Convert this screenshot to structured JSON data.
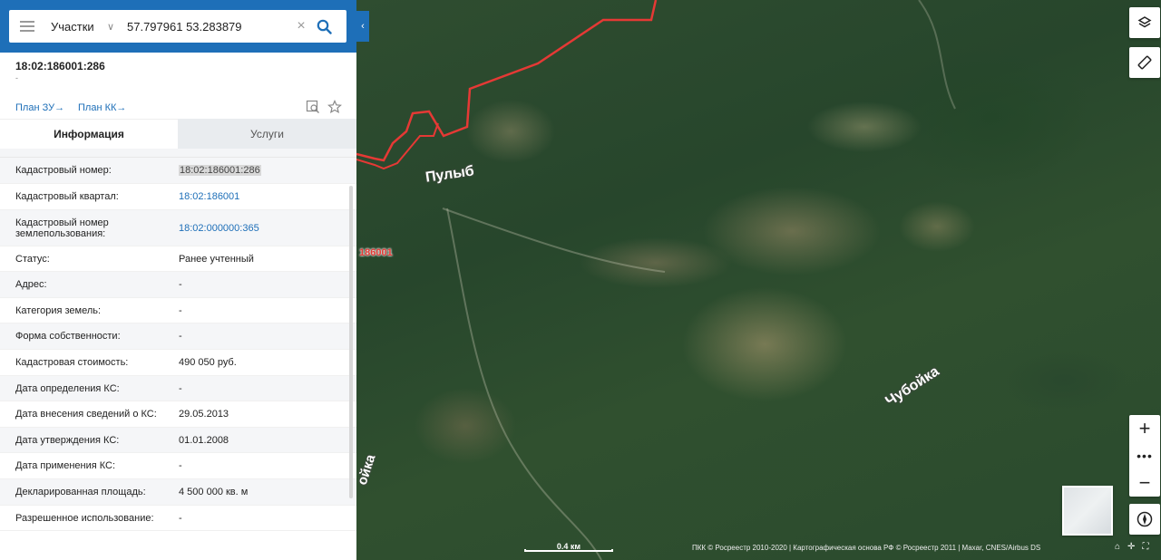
{
  "search": {
    "category": "Участки",
    "query": "57.797961 53.283879"
  },
  "object": {
    "cadastral_number": "18:02:186001:286",
    "subtitle": "-"
  },
  "links": {
    "plan_zu": "План ЗУ→",
    "plan_kk": "План КК→"
  },
  "tabs": [
    {
      "label": "Информация"
    },
    {
      "label": "Услуги"
    }
  ],
  "info_rows": [
    {
      "key": "Кадастровый номер:",
      "value": "18:02:186001:286"
    },
    {
      "key": "Кадастровый квартал:",
      "value": "18:02:186001"
    },
    {
      "key": "Кадастровый номер землепользования:",
      "value": "18:02:000000:365"
    },
    {
      "key": "Статус:",
      "value": "Ранее учтенный"
    },
    {
      "key": "Адрес:",
      "value": "-"
    },
    {
      "key": "Категория земель:",
      "value": "-"
    },
    {
      "key": "Форма собственности:",
      "value": "-"
    },
    {
      "key": "Кадастровая стоимость:",
      "value": "490 050 руб."
    },
    {
      "key": "Дата определения КС:",
      "value": "-"
    },
    {
      "key": "Дата внесения сведений о КС:",
      "value": "29.05.2013"
    },
    {
      "key": "Дата утверждения КС:",
      "value": "01.01.2008"
    },
    {
      "key": "Дата применения КС:",
      "value": "-"
    },
    {
      "key": "Декларированная площадь:",
      "value": "4 500 000 кв. м"
    },
    {
      "key": "Разрешенное использование:",
      "value": "-"
    }
  ],
  "map": {
    "labels": {
      "pulyb": "Пулыб",
      "chuboyka": "Чубойка",
      "vertical": "ойка",
      "quarter": "186001"
    },
    "scale": "0.4 км",
    "attribution": "ПКК © Росреестр 2010-2020 | Картографическая основа РФ © Росреестр 2011 | Maxar, CNES/Airbus DS"
  },
  "colors": {
    "header_blue": "#1e6fb8",
    "boundary_red": "#e53935"
  }
}
